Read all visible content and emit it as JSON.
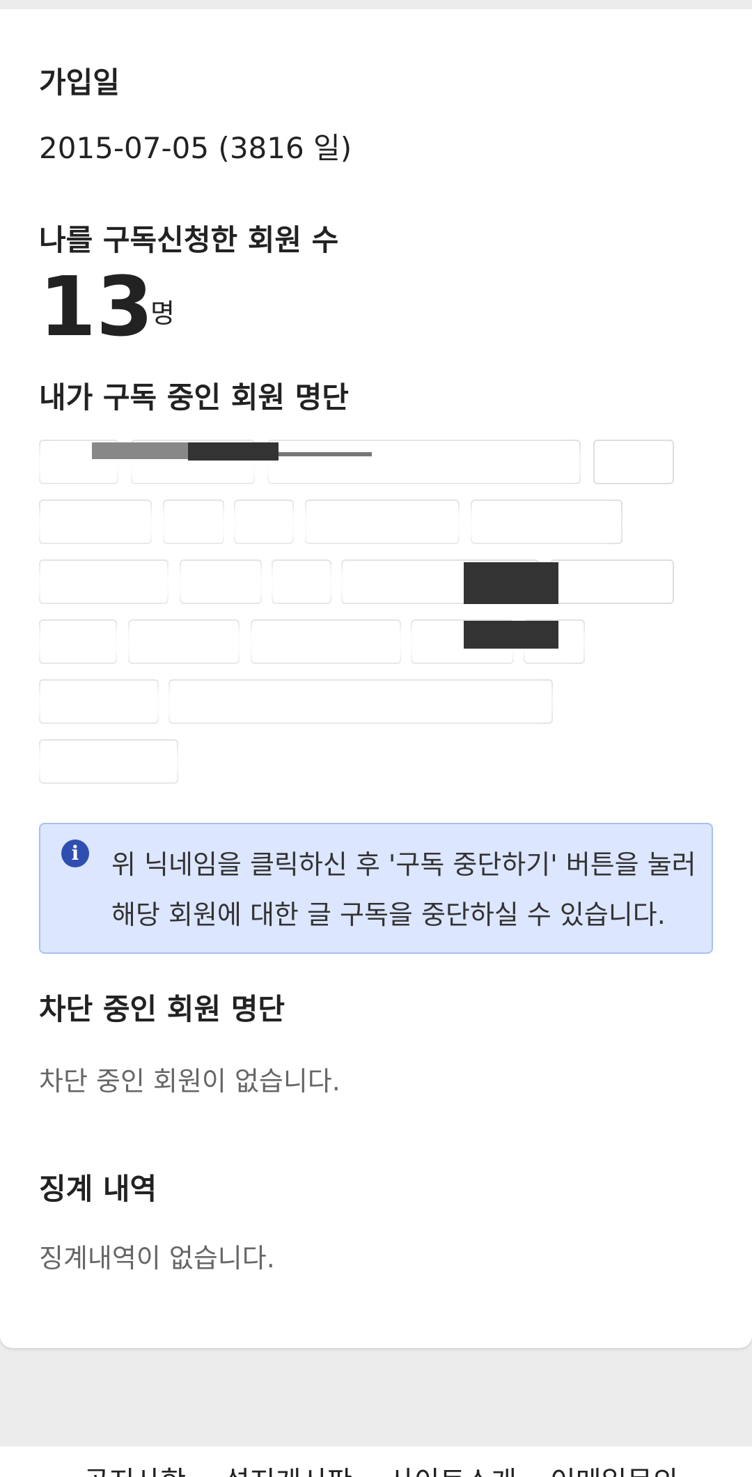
{
  "join_date": {
    "heading": "가입일",
    "value": "2015-07-05 (3816 일)"
  },
  "subscribers": {
    "heading": "나를 구독신청한 회원 수",
    "count": "13",
    "unit": "명"
  },
  "subscribing": {
    "heading": "내가 구독 중인 회원 명단"
  },
  "notice": {
    "icon": "info-icon",
    "text": "위 닉네임을 클릭하신 후 '구독 중단하기' 버튼을 눌러 해당 회원에 대한 글 구독을 중단하실 수 있습니다."
  },
  "blocked": {
    "heading": "차단 중인 회원 명단",
    "empty": "차단 중인 회원이 없습니다."
  },
  "discipline": {
    "heading": "징계 내역",
    "empty": "징계내역이 없습니다."
  },
  "footer": {
    "links": [
      "공지사항",
      "설지게시판",
      "사이트소개",
      "이메일문의"
    ]
  },
  "colors": {
    "notice_bg": "#dce6ff",
    "notice_border": "#a8c0ee",
    "info_icon": "#2f4fb0"
  }
}
